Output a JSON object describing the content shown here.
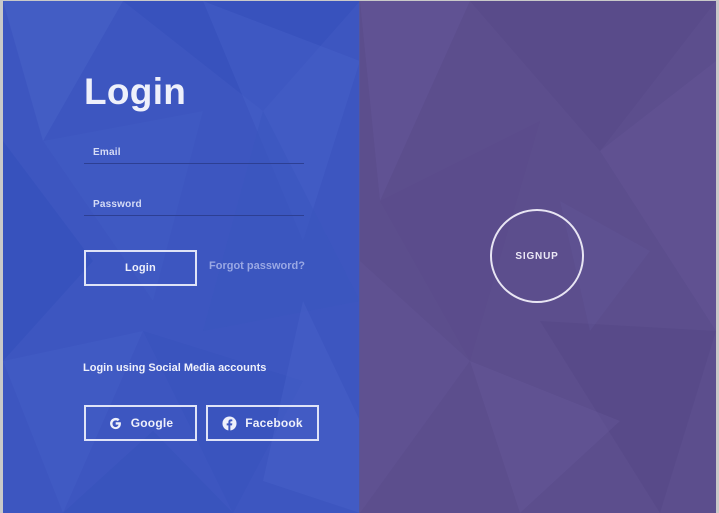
{
  "colors": {
    "left_panel": "#3d56c0",
    "right_panel": "#5c4e8d",
    "text_light": "#eef0fb",
    "link_muted": "#9aa8e4"
  },
  "login": {
    "title": "Login",
    "email_label": "Email",
    "password_label": "Password",
    "login_button": "Login",
    "forgot_link": "Forgot password?",
    "social_caption": "Login using Social Media accounts",
    "google_button": "Google",
    "facebook_button": "Facebook",
    "google_icon": "google-g-icon",
    "facebook_icon": "facebook-logo-icon"
  },
  "signup": {
    "button": "SIGNUP"
  }
}
